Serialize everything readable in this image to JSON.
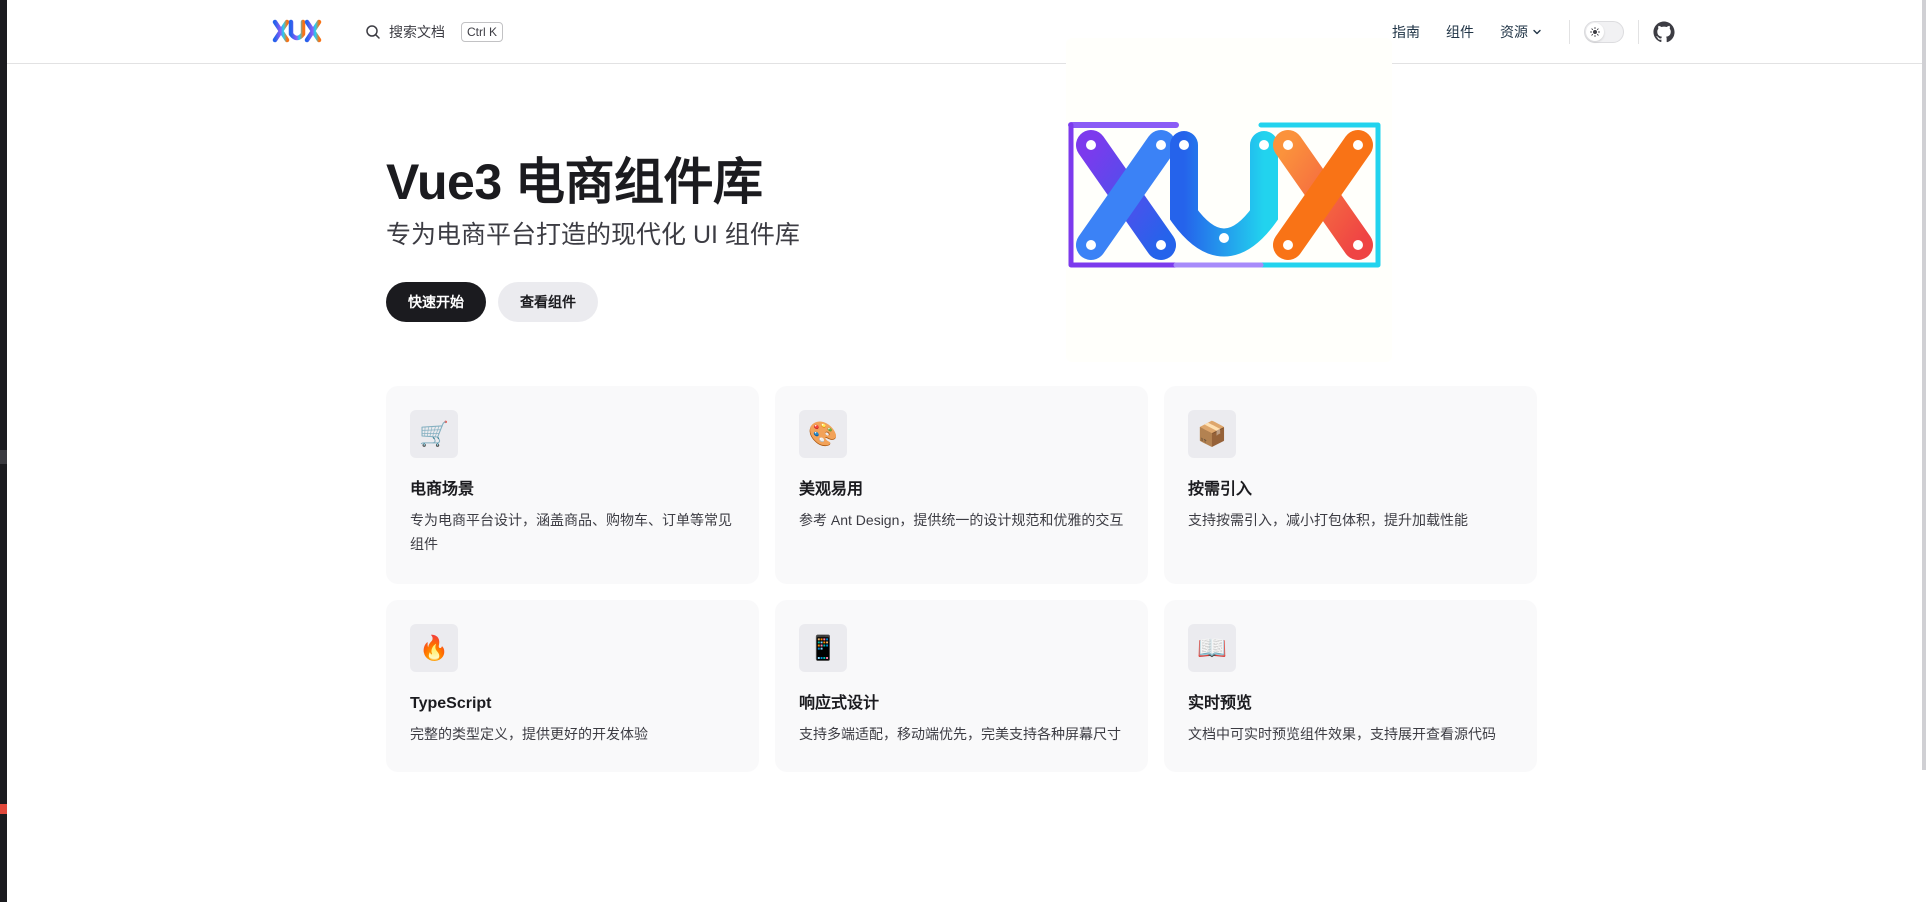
{
  "brand": {
    "logo_text": "XUX"
  },
  "search": {
    "label": "搜索文档",
    "shortcut": "Ctrl K"
  },
  "nav": {
    "links": [
      {
        "label": "指南"
      },
      {
        "label": "组件"
      },
      {
        "label": "资源"
      }
    ]
  },
  "hero": {
    "title": "Vue3 电商组件库",
    "tagline": "专为电商平台打造的现代化 UI 组件库",
    "primary_action": "快速开始",
    "secondary_action": "查看组件",
    "image_text": "XUX"
  },
  "features": [
    {
      "icon": "🛒",
      "icon_name": "shopping-cart-icon",
      "title": "电商场景",
      "details": "专为电商平台设计，涵盖商品、购物车、订单等常见组件"
    },
    {
      "icon": "🎨",
      "icon_name": "palette-icon",
      "title": "美观易用",
      "details": "参考 Ant Design，提供统一的设计规范和优雅的交互"
    },
    {
      "icon": "📦",
      "icon_name": "package-icon",
      "title": "按需引入",
      "details": "支持按需引入，减小打包体积，提升加载性能"
    },
    {
      "icon": "🔥",
      "icon_name": "fire-icon",
      "title": "TypeScript",
      "details": "完整的类型定义，提供更好的开发体验"
    },
    {
      "icon": "📱",
      "icon_name": "mobile-icon",
      "title": "响应式设计",
      "details": "支持多端适配，移动端优先，完美支持各种屏幕尺寸"
    },
    {
      "icon": "📖",
      "icon_name": "book-icon",
      "title": "实时预览",
      "details": "文档中可实时预览组件效果，支持展开查看源代码"
    }
  ],
  "colors": {
    "brand_dark": "#1b1b1f",
    "card_bg": "#f9f9fa",
    "logo_purple": "#7c3aed",
    "logo_blue": "#2563eb",
    "logo_cyan": "#22d3ee",
    "logo_orange": "#f97316"
  }
}
